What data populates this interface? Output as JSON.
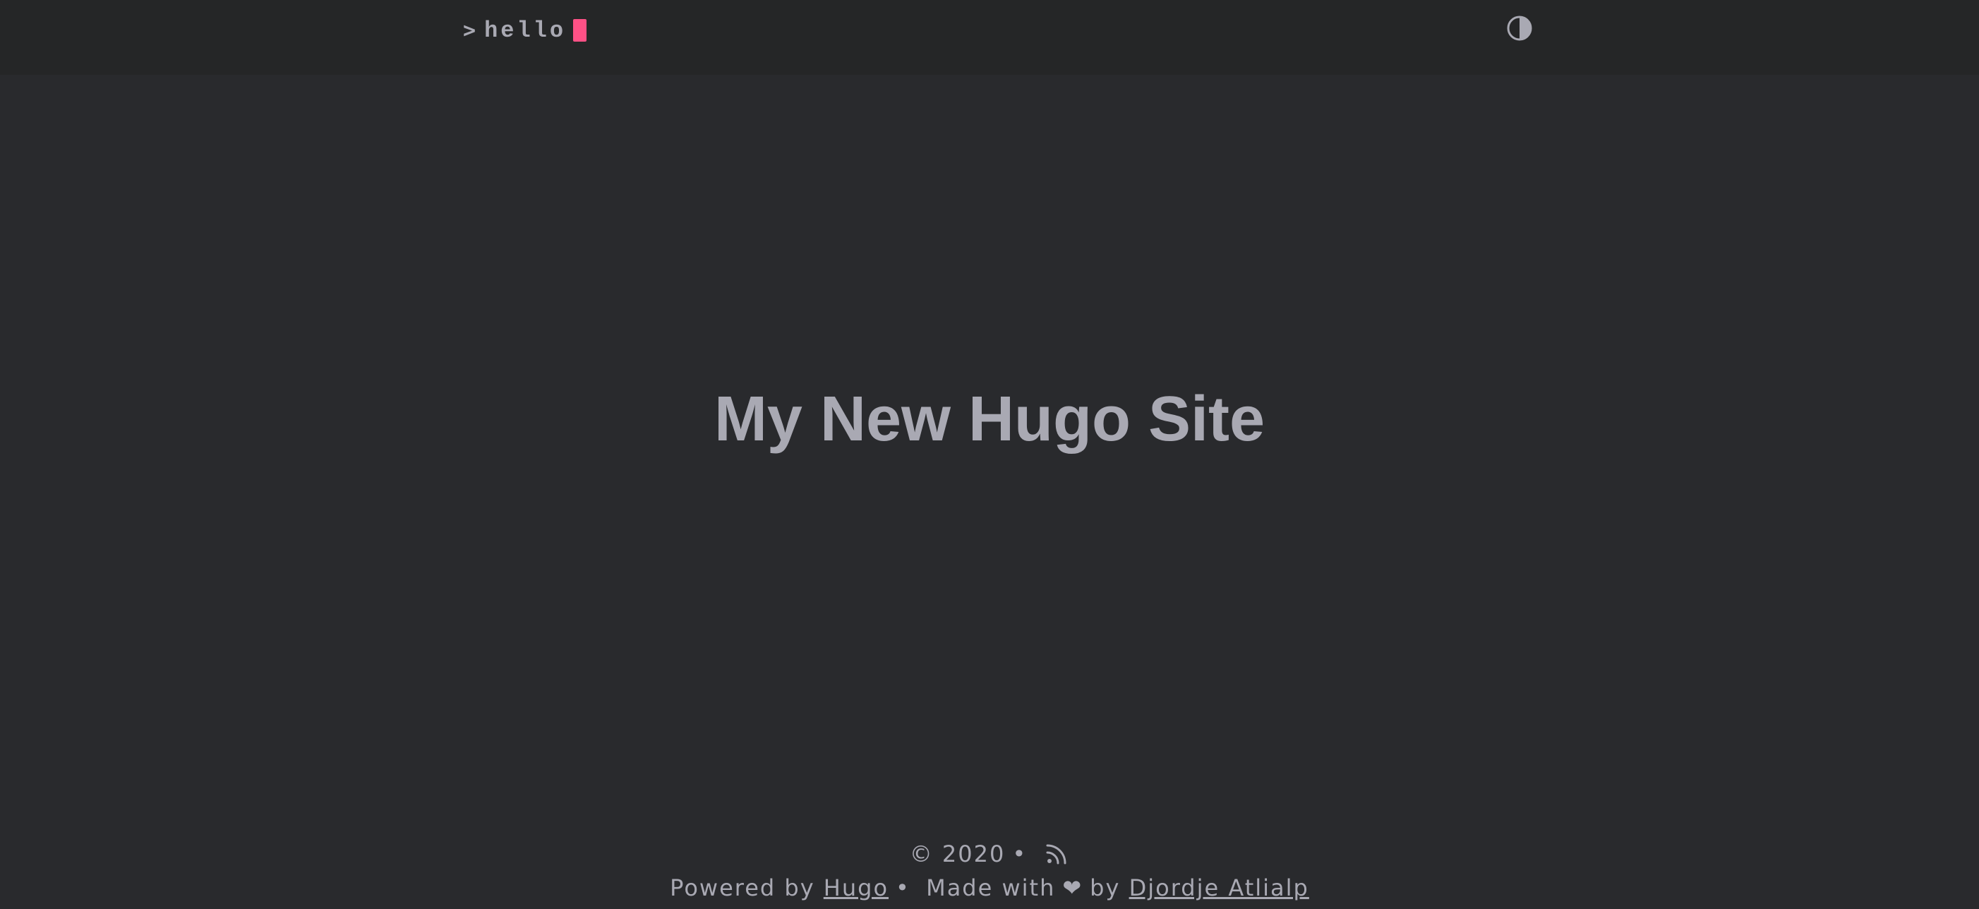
{
  "header": {
    "logo_prompt": ">",
    "logo_text": "hello",
    "cursor_color": "#fe5186",
    "theme_toggle_icon": "contrast-half-circle-icon"
  },
  "main": {
    "title": "My New Hugo Site"
  },
  "footer": {
    "copyright": "© 2020",
    "separator": "•",
    "rss_icon": "rss-icon",
    "powered_by_prefix": "Powered by",
    "powered_by_link": "Hugo",
    "made_with_prefix": "Made with",
    "heart": "❤",
    "by_text": "by",
    "author_link": "Djordje Atlialp"
  },
  "colors": {
    "background": "#292a2d",
    "header_background": "#252627",
    "text": "#a9a9b3",
    "accent": "#fe5186"
  }
}
